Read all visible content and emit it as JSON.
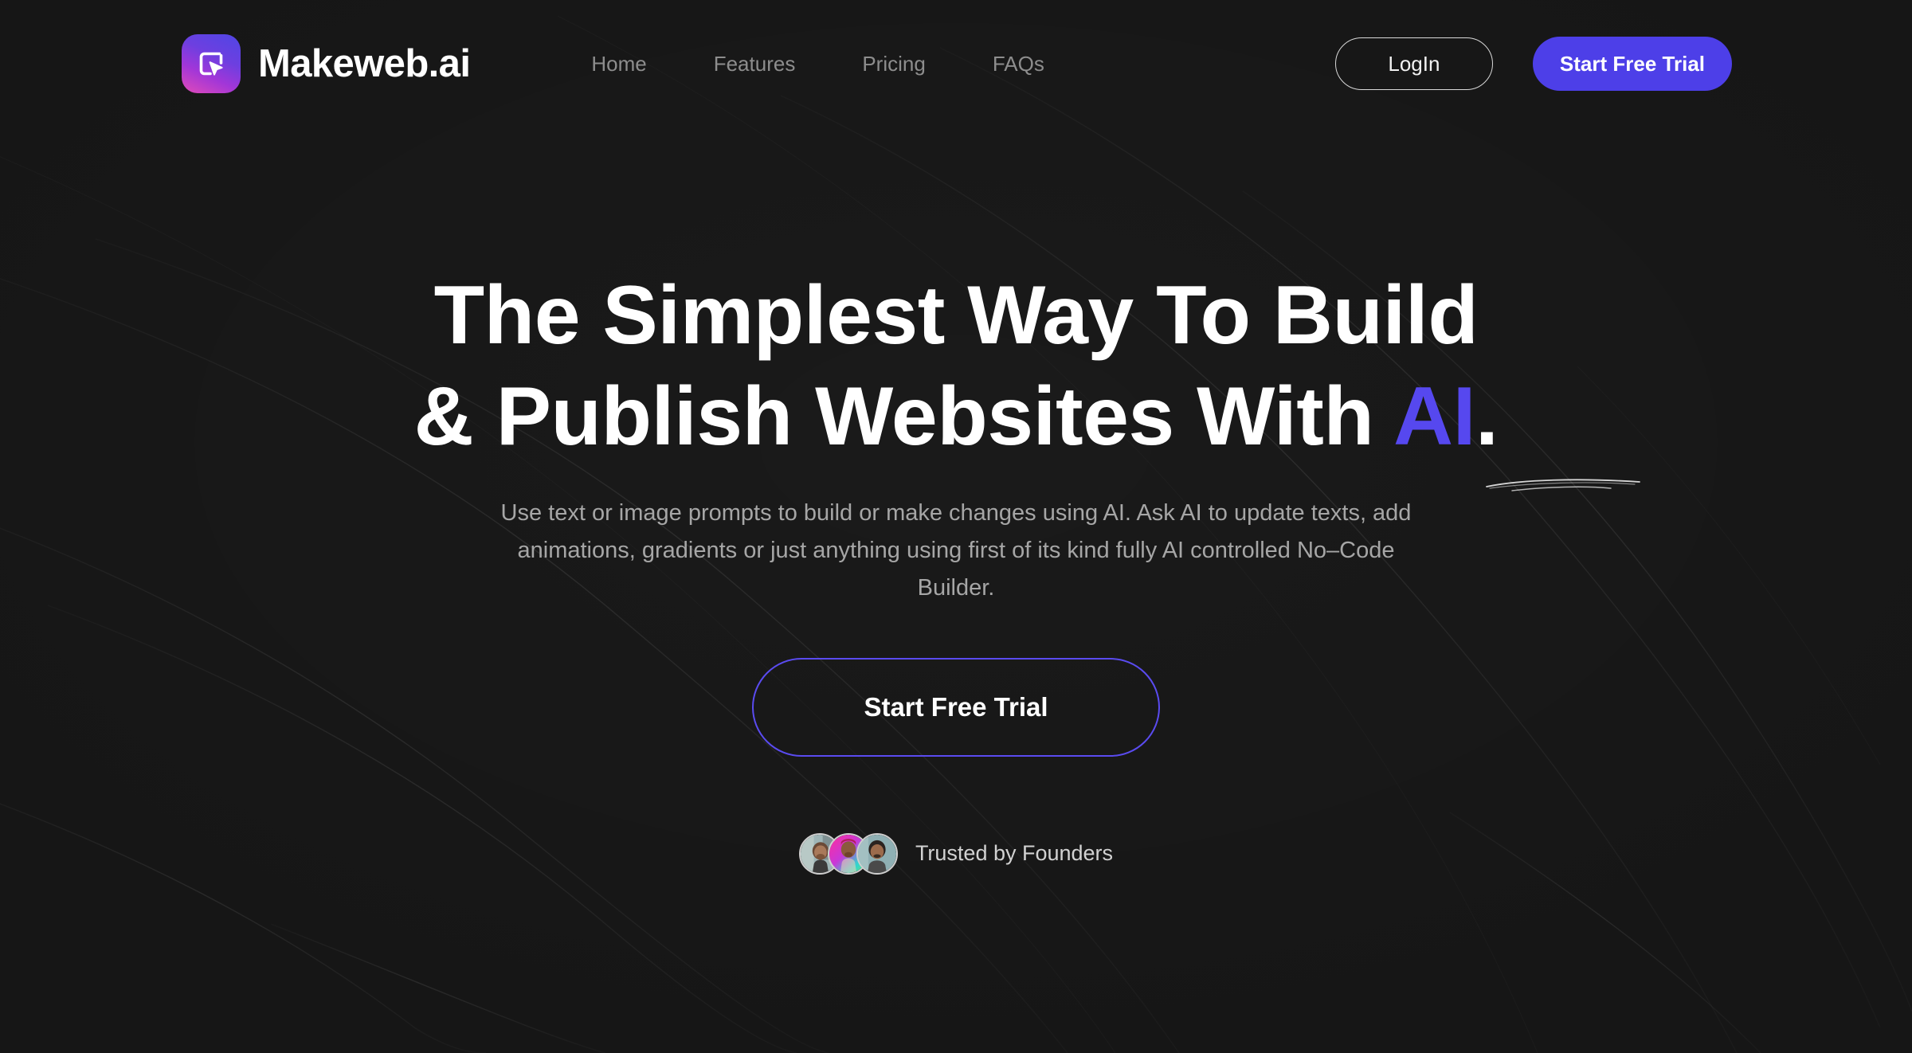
{
  "theme": {
    "background": "#161616",
    "accent": "#4d3fe8",
    "accent_outline": "#5a4bf0",
    "headline_accent": "#5648ef",
    "nav_text": "#8d8d8d",
    "body_text": "#a6a6a6"
  },
  "header": {
    "brand_name": "Makeweb.ai",
    "logo_icon": "cursor-in-frame-icon",
    "nav": [
      {
        "label": "Home"
      },
      {
        "label": "Features"
      },
      {
        "label": "Pricing"
      },
      {
        "label": "FAQs"
      }
    ],
    "login_label": "LogIn",
    "cta_label": "Start Free Trial"
  },
  "hero": {
    "headline_line1": "The Simplest Way To Build",
    "headline_line2_prefix": "& Publish Websites With ",
    "headline_accent": "AI",
    "headline_period": ".",
    "subtitle": "Use text or image prompts to build or make changes using AI. Ask AI to update texts, add animations, gradients or just anything using first of its kind fully AI controlled No–Code Builder.",
    "cta_label": "Start Free Trial"
  },
  "trust": {
    "label": "Trusted by Founders",
    "avatar_count": 3,
    "avatars": [
      {
        "name": "founder-avatar-1"
      },
      {
        "name": "founder-avatar-2"
      },
      {
        "name": "founder-avatar-3"
      }
    ]
  }
}
